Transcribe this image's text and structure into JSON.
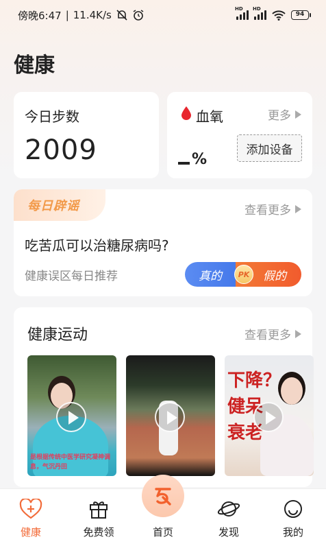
{
  "status_bar": {
    "time": "傍晚6:47",
    "network_speed": "11.4K/s",
    "battery": "94"
  },
  "page": {
    "title": "健康"
  },
  "steps_card": {
    "label": "今日步数",
    "value": "2009"
  },
  "oxygen_card": {
    "label": "血氧",
    "more": "更多",
    "value": "%",
    "add_device": "添加设备"
  },
  "rumor_card": {
    "tag": "每日辟谣",
    "more": "查看更多",
    "question": "吃苦瓜可以治糖尿病吗?",
    "subtitle": "健康误区每日推荐",
    "true_label": "真的",
    "pk_label": "PK",
    "false_label": "假的"
  },
  "exercise_card": {
    "title": "健康运动",
    "more": "查看更多",
    "videos": [
      {
        "caption": "是根据传统中医学研究凝神调息，气沉丹田"
      },
      {
        "caption": ""
      },
      {
        "caption": "下降？\n健呆\n衰老"
      }
    ]
  },
  "tab_bar": {
    "items": [
      {
        "label": "健康",
        "icon": "heart-plus-icon",
        "active": true
      },
      {
        "label": "免费领",
        "icon": "gift-icon",
        "active": false
      },
      {
        "label": "首页",
        "icon": "home-logo-icon",
        "active": false
      },
      {
        "label": "发现",
        "icon": "planet-icon",
        "active": false
      },
      {
        "label": "我的",
        "icon": "smiley-icon",
        "active": false
      }
    ]
  },
  "colors": {
    "accent": "#f26c3a",
    "blue": "#3f73e8",
    "orange": "#f15b2d"
  }
}
